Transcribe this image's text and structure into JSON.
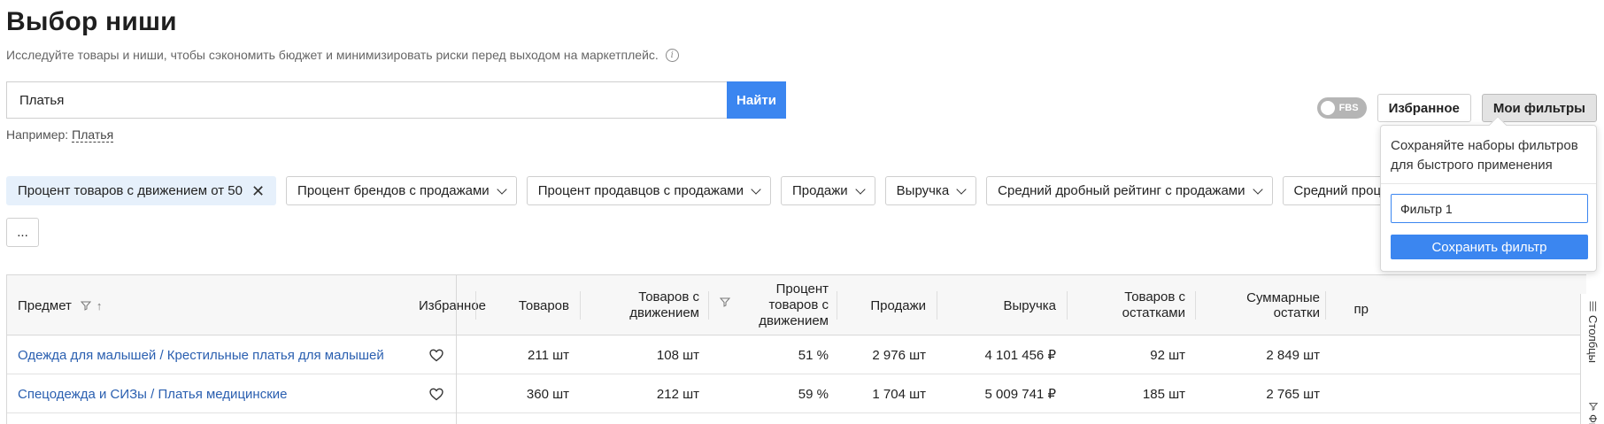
{
  "page": {
    "title": "Выбор ниши",
    "subtitle": "Исследуйте товары и ниши, чтобы сэкономить бюджет и минимизировать риски перед выходом на маркетплейс."
  },
  "search": {
    "value": "Платья",
    "button": "Найти",
    "example_label": "Например:",
    "example_value": "Платья"
  },
  "toolbar": {
    "fbs_label": "FBS",
    "favorites": "Избранное",
    "my_filters": "Мои фильтры"
  },
  "filters": {
    "chips": [
      {
        "label": "Процент товаров с движением от 50",
        "active": true
      },
      {
        "label": "Процент брендов с продажами",
        "active": false
      },
      {
        "label": "Процент продавцов с продажами",
        "active": false
      },
      {
        "label": "Продажи",
        "active": false
      },
      {
        "label": "Выручка",
        "active": false
      },
      {
        "label": "Средний дробный рейтинг с продажами",
        "active": false
      },
      {
        "label": "Средний проц",
        "active": false
      }
    ],
    "more": "..."
  },
  "popup": {
    "text": "Сохраняйте наборы фильтров для быстрого применения",
    "input_value": "Фильтр 1",
    "save": "Сохранить фильтр"
  },
  "table": {
    "columns": {
      "subject": "Предмет",
      "favorites": "Избранное",
      "products": "Товаров",
      "moving": "Товаров с движением",
      "moving_pct": "Процент товаров с движением",
      "sales": "Продажи",
      "revenue": "Выручка",
      "in_stock": "Товаров с остатками",
      "stock_total": "Суммарные остатки",
      "cut": "пр"
    },
    "rows": [
      {
        "subject": "Одежда для малышей / Крестильные платья для малышей",
        "products": "211 шт",
        "moving": "108 шт",
        "moving_pct": "51 %",
        "sales": "2 976 шт",
        "revenue": "4 101 456 ₽",
        "in_stock": "92 шт",
        "stock_total": "2 849 шт"
      },
      {
        "subject": "Спецодежда и СИЗы / Платья медицинские",
        "products": "360 шт",
        "moving": "212 шт",
        "moving_pct": "59 %",
        "sales": "1 704 шт",
        "revenue": "5 009 741 ₽",
        "in_stock": "185 шт",
        "stock_total": "2 765 шт"
      }
    ]
  },
  "side_panel": {
    "columns": "Столбцы",
    "filters": "Фи"
  }
}
